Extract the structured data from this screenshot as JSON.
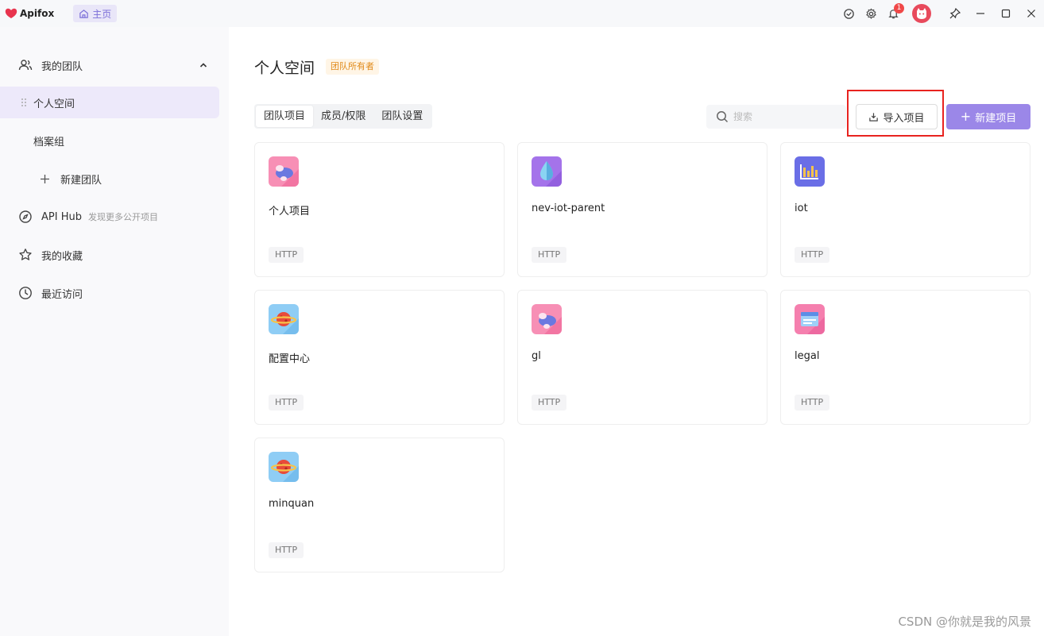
{
  "app": {
    "name": "Apifox",
    "home_tab": "主页"
  },
  "topbar": {
    "notification_count": "1"
  },
  "sidebar": {
    "team_group": "我的团队",
    "items": [
      {
        "label": "个人空间"
      },
      {
        "label": "档案组"
      },
      {
        "label": "新建团队"
      },
      {
        "label": "API Hub",
        "sub": "发现更多公开项目"
      },
      {
        "label": "我的收藏"
      },
      {
        "label": "最近访问"
      }
    ]
  },
  "main": {
    "title": "个人空间",
    "owner_tag": "团队所有者",
    "tabs": [
      {
        "label": "团队项目"
      },
      {
        "label": "成员/权限"
      },
      {
        "label": "团队设置"
      }
    ],
    "search_placeholder": "搜索",
    "import_label": "导入项目",
    "new_label": "新建项目"
  },
  "projects": [
    {
      "name": "个人项目",
      "tag": "HTTP",
      "icon": "cloud-icon"
    },
    {
      "name": "nev-iot-parent",
      "tag": "HTTP",
      "icon": "drop-icon"
    },
    {
      "name": "iot",
      "tag": "HTTP",
      "icon": "chart-icon"
    },
    {
      "name": "配置中心",
      "tag": "HTTP",
      "icon": "planet-icon"
    },
    {
      "name": "gl",
      "tag": "HTTP",
      "icon": "cloud-icon"
    },
    {
      "name": "legal",
      "tag": "HTTP",
      "icon": "card-icon"
    },
    {
      "name": "minquan",
      "tag": "HTTP",
      "icon": "planet-icon"
    }
  ],
  "watermark": "CSDN @你就是我的风景"
}
